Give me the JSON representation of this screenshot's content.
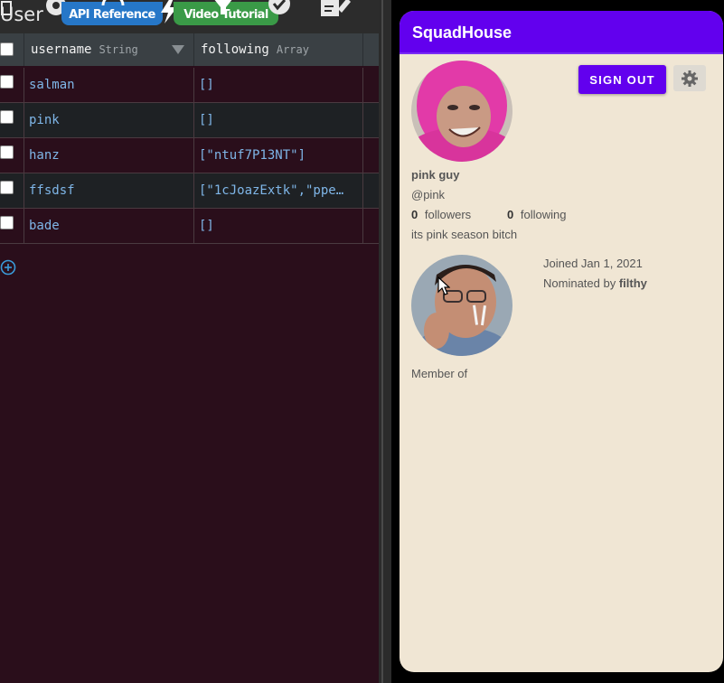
{
  "db": {
    "class_name": "User",
    "toolbar": {
      "api_label": "API Reference",
      "video_label": "Video Tutorial"
    },
    "columns": [
      {
        "name": "username",
        "type": "String"
      },
      {
        "name": "following",
        "type": "Array"
      }
    ],
    "rows": [
      {
        "username": "salman",
        "following": "[]"
      },
      {
        "username": "pink",
        "following": "[]"
      },
      {
        "username": "hanz",
        "following": "[\"ntuf7P13NT\"]"
      },
      {
        "username": "ffsdsf",
        "following": "[\"1cJoazExtk\",\"ppe…"
      },
      {
        "username": "bade",
        "following": "[]"
      }
    ],
    "colors": {
      "panel_bg": "#2a0e1b",
      "cell_text": "#7fb6e8",
      "add_icon": "#3a9ad9"
    }
  },
  "app": {
    "title": "SquadHouse",
    "sign_out_label": "SIGN OUT",
    "profile": {
      "display_name": "pink guy",
      "handle": "@pink",
      "followers_count": "0",
      "followers_label": "followers",
      "following_count": "0",
      "following_label": "following",
      "bio": "its pink season bitch"
    },
    "joined_text": "Joined Jan 1, 2021",
    "nominated_prefix": "Nominated by",
    "nominated_by": "filthy",
    "member_of_label": "Member of",
    "colors": {
      "primary": "#6200ee",
      "background": "#f0e6d4"
    }
  }
}
